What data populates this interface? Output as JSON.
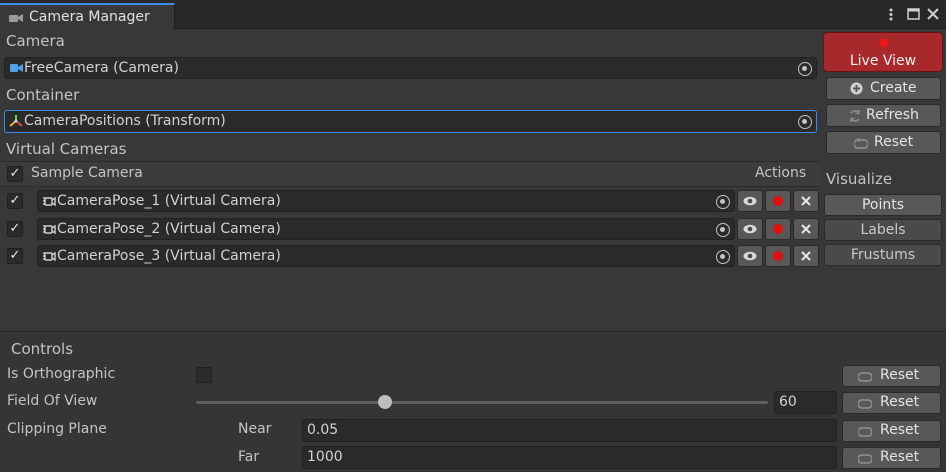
{
  "window": {
    "tab_title": "Camera Manager",
    "menu_icon": "kebab-menu-icon",
    "maximize_icon": "maximize-icon",
    "close_icon": "close-icon"
  },
  "camera": {
    "label": "Camera",
    "value": "FreeCamera (Camera)",
    "icon": "camera-icon"
  },
  "container": {
    "label": "Container",
    "value": "CameraPositions (Transform)",
    "icon": "transform-icon"
  },
  "virtual_cameras": {
    "label": "Virtual Cameras",
    "header_label": "Sample Camera",
    "actions_label": "Actions",
    "header_checked": true,
    "items": [
      {
        "label": "CameraPose_1 (Virtual Camera)",
        "checked": true
      },
      {
        "label": "CameraPose_2 (Virtual Camera)",
        "checked": true
      },
      {
        "label": "CameraPose_3 (Virtual Camera)",
        "checked": true
      }
    ]
  },
  "sidebar": {
    "live_view": "Live View",
    "create": "Create",
    "refresh": "Refresh",
    "reset": "Reset",
    "visualize_label": "Visualize",
    "points": "Points",
    "labels": "Labels",
    "frustums": "Frustums"
  },
  "controls": {
    "title": "Controls",
    "orthographic_label": "Is Orthographic",
    "orthographic_checked": false,
    "fov_label": "Field Of View",
    "fov_value": "60",
    "fov_slider_fraction": 0.33,
    "clipping_label": "Clipping Plane",
    "near_label": "Near",
    "near_value": "0.05",
    "far_label": "Far",
    "far_value": "1000",
    "reset_label": "Reset"
  },
  "colors": {
    "accent": "#3b8ee8",
    "live_view": "#a8292b",
    "record_dot": "#e01010"
  }
}
